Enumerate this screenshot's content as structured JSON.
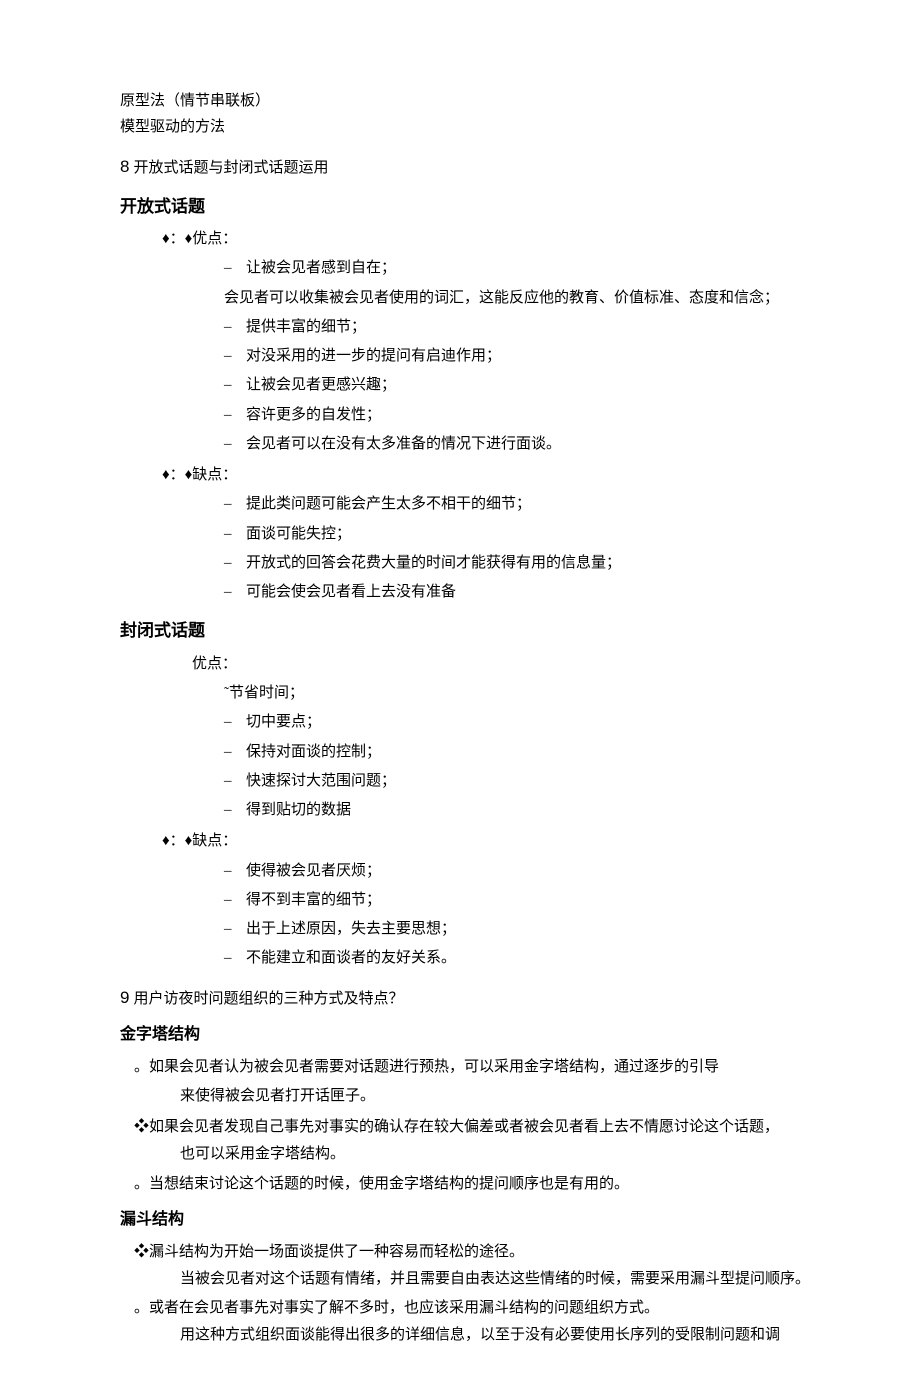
{
  "top": {
    "line1": "原型法（情节串联板）",
    "line2": "模型驱动的方法"
  },
  "sec8": {
    "title": "开放式话题与封闭式话题运用",
    "num": "8",
    "open": {
      "heading": "开放式话题",
      "pros_label": "♦：♦优点：",
      "pros": [
        "让被会见者感到自在；",
        "会见者可以收集被会见者使用的词汇，这能反应他的教育、价值标准、态度和信念；",
        "提供丰富的细节；",
        "对没采用的进一步的提问有启迪作用；",
        "让被会见者更感兴趣；",
        "容许更多的自发性；",
        "会见者可以在没有太多准备的情况下进行面谈。"
      ],
      "cons_label": "♦：♦缺点：",
      "cons": [
        "提此类问题可能会产生太多不相干的细节；",
        "面谈可能失控；",
        "开放式的回答会花费大量的时间才能获得有用的信息量；",
        "可能会使会见者看上去没有准备"
      ]
    },
    "closed": {
      "heading": "封闭式话题",
      "pros_label": "优点：",
      "pros_first": "˜节省时间；",
      "pros": [
        "切中要点；",
        "保持对面谈的控制；",
        "快速探讨大范围问题；",
        "得到贴切的数据"
      ],
      "cons_label": "♦：♦缺点：",
      "cons": [
        "使得被会见者厌烦；",
        "得不到丰富的细节；",
        "出于上述原因，失去主要思想；",
        "不能建立和面谈者的友好关系。"
      ]
    }
  },
  "sec9": {
    "num": "9",
    "title": "用户访夜时问题组织的三种方式及特点？",
    "pyramid": {
      "heading": "金字塔结构",
      "p1a": "。如果会见者认为被会见者需要对话题进行预热，可以采用金字塔结构，通过逐步的引导",
      "p1b": "来使得被会见者打开话匣子。",
      "p2a": "❖如果会见者发现自己事先对事实的确认存在较大偏差或者被会见者看上去不情愿讨论这个话题，",
      "p2b": "也可以采用金字塔结构。",
      "p3": "。当想结束讨论这个话题的时候，使用金字塔结构的提问顺序也是有用的。"
    },
    "funnel": {
      "heading": "漏斗结构",
      "p1": "❖漏斗结构为开始一场面谈提供了一种容易而轻松的途径。",
      "p2": "当被会见者对这个话题有情绪，并且需要自由表达这些情绪的时候，需要采用漏斗型提问顺序。",
      "p3": "。或者在会见者事先对事实了解不多时，也应该采用漏斗结构的问题组织方式。",
      "p4": "用这种方式组织面谈能得出很多的详细信息，以至于没有必要使用长序列的受限制问题和调"
    }
  }
}
